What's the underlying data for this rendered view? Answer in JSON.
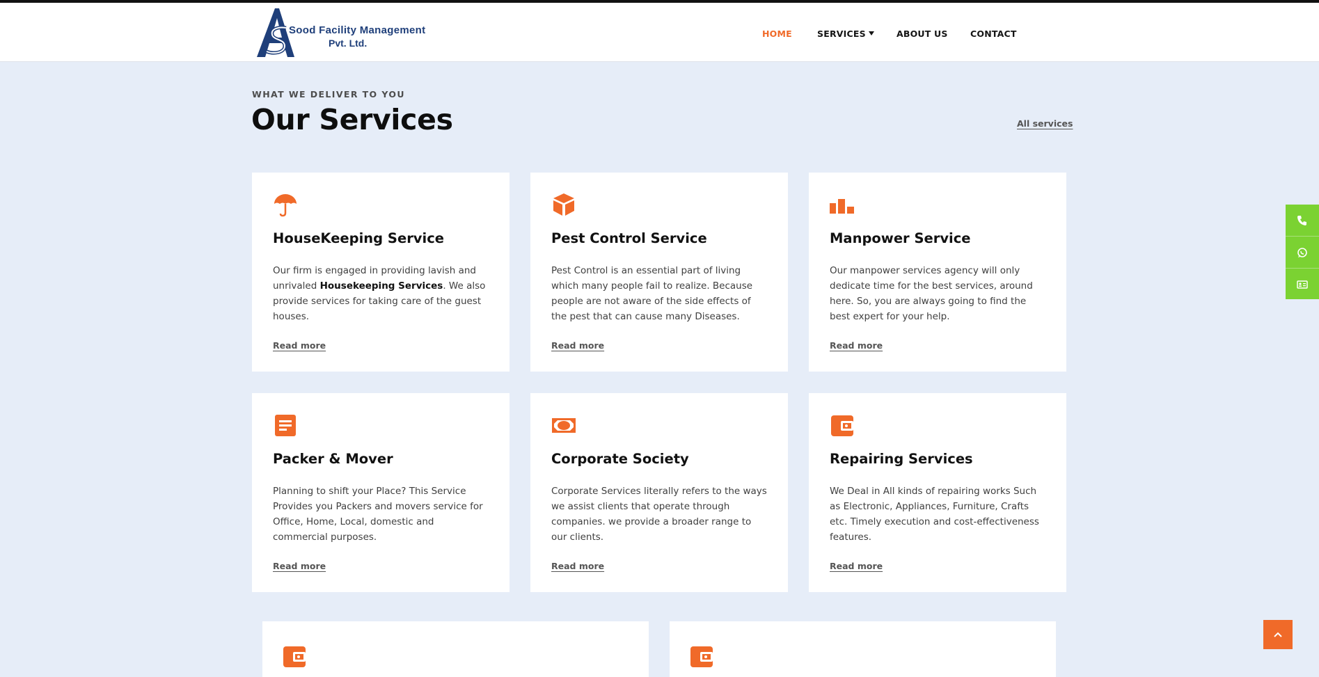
{
  "brand": {
    "name_line1": "Sood Facility Management",
    "name_line2": "Pvt. Ltd.",
    "logo_letters": "AS",
    "color_primary": "#1f3f7a"
  },
  "nav": {
    "items": [
      {
        "label": "HOME",
        "active": true
      },
      {
        "label": "SERVICES",
        "has_dropdown": true
      },
      {
        "label": "ABOUT US"
      },
      {
        "label": "CONTACT"
      }
    ]
  },
  "section": {
    "eyebrow": "WHAT WE DELIVER TO YOU",
    "title": "Our Services",
    "all_link": "All services"
  },
  "services": [
    {
      "icon": "umbrella-icon",
      "title": "HouseKeeping Service",
      "text_before": "Our firm is engaged in providing lavish and unrivaled ",
      "text_bold": "Housekeeping Services",
      "text_after": ". We also provide services for taking care of the guest houses.",
      "more": "Read more"
    },
    {
      "icon": "box-icon",
      "title": "Pest Control Service",
      "text": "Pest Control is an essential part of living which many people fail to realize. Because people are not aware of the side effects of the pest that can cause many Diseases.",
      "more": "Read more"
    },
    {
      "icon": "bar-chart-icon",
      "title": "Manpower Service",
      "text": "Our manpower services agency will only dedicate time for the best services, around here. So, you are always going to find the best expert for your help.",
      "more": "Read more"
    },
    {
      "icon": "document-icon",
      "title": "Packer & Mover",
      "text": "Planning to shift your Place? This Service Provides you Packers and movers service for Office, Home, Local, domestic and commercial purposes.",
      "more": "Read more"
    },
    {
      "icon": "money-icon",
      "title": "Corporate Society",
      "text": "Corporate Services literally refers to the ways we assist clients that operate through companies. we provide a broader range to our clients.",
      "more": "Read more"
    },
    {
      "icon": "wallet-icon",
      "title": "Repairing Services",
      "text": "We Deal in All kinds of repairing works Such as Electronic,  Appliances, Furniture, Crafts etc. Timely execution and cost-effectiveness features.",
      "more": "Read more"
    }
  ],
  "partial_cards": [
    {
      "icon": "wallet-icon"
    },
    {
      "icon": "wallet-icon"
    }
  ],
  "floating": {
    "buttons": [
      "phone-icon",
      "whatsapp-icon",
      "contact-card-icon"
    ],
    "color": "#7bd232"
  },
  "scroll_top": {
    "icon": "chevron-up-icon",
    "color": "#f06a29"
  },
  "accent_color": "#f06a29"
}
